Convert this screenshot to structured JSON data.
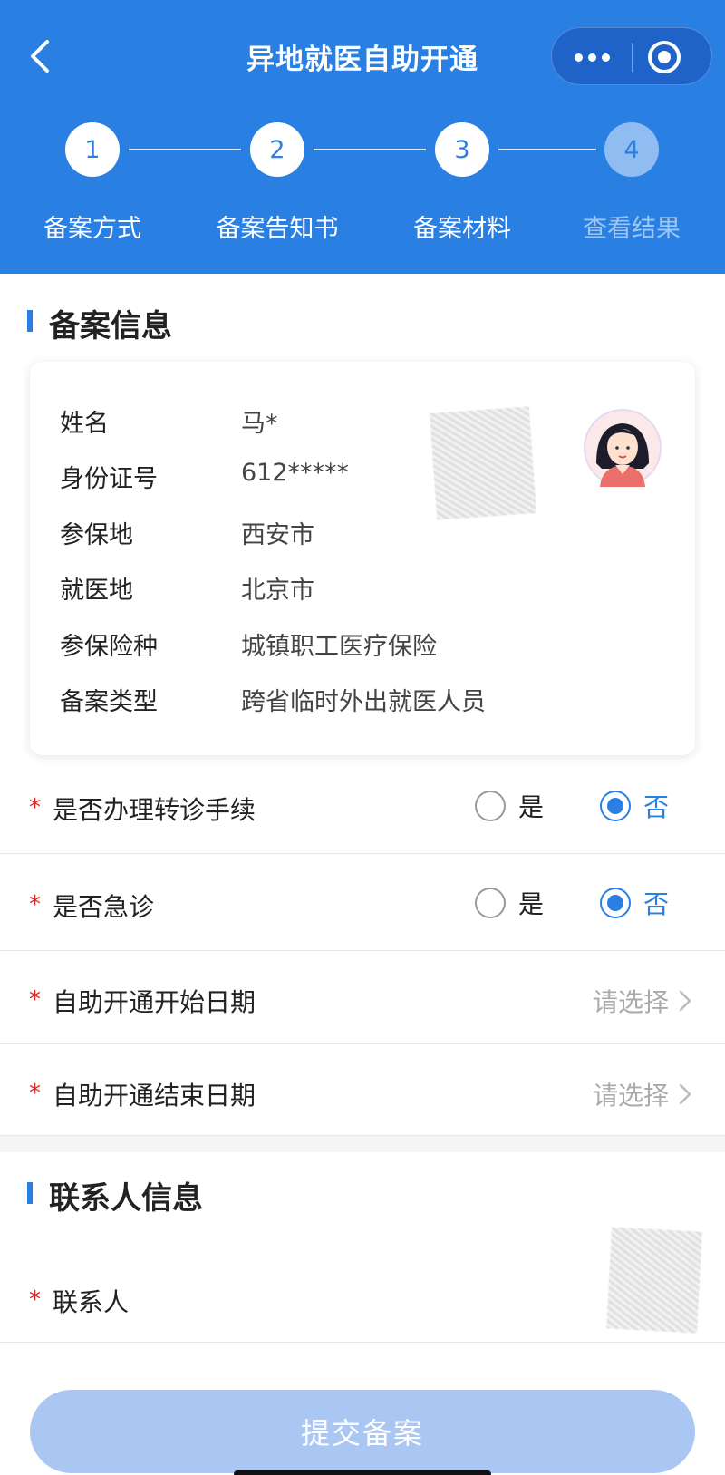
{
  "nav": {
    "title": "异地就医自助开通"
  },
  "steps": [
    {
      "number": "1",
      "label": "备案方式",
      "active": true
    },
    {
      "number": "2",
      "label": "备案告知书",
      "active": true
    },
    {
      "number": "3",
      "label": "备案材料",
      "active": true
    },
    {
      "number": "4",
      "label": "查看结果",
      "active": false
    }
  ],
  "filing_section": {
    "title": "备案信息",
    "rows": [
      {
        "label": "姓名",
        "value": "马*"
      },
      {
        "label": "身份证号",
        "value": "612*****"
      },
      {
        "label": "参保地",
        "value": "西安市"
      },
      {
        "label": "就医地",
        "value": "北京市"
      },
      {
        "label": "参保险种",
        "value": "城镇职工医疗保险"
      },
      {
        "label": "备案类型",
        "value": "跨省临时外出就医人员"
      }
    ]
  },
  "form": {
    "required_mark": "*",
    "transfer": {
      "label": "是否办理转诊手续",
      "yes": "是",
      "no": "否",
      "selected": "否"
    },
    "emergency": {
      "label": "是否急诊",
      "yes": "是",
      "no": "否",
      "selected": "否"
    },
    "start_date": {
      "label": "自助开通开始日期",
      "placeholder": "请选择"
    },
    "end_date": {
      "label": "自助开通结束日期",
      "placeholder": "请选择"
    }
  },
  "contact_section": {
    "title": "联系人信息",
    "contact_label": "联系人"
  },
  "submit": {
    "label": "提交备案"
  },
  "colors": {
    "brand": "#2a7fe3",
    "required": "#e0251e",
    "submit_disabled": "#aac6f2"
  }
}
